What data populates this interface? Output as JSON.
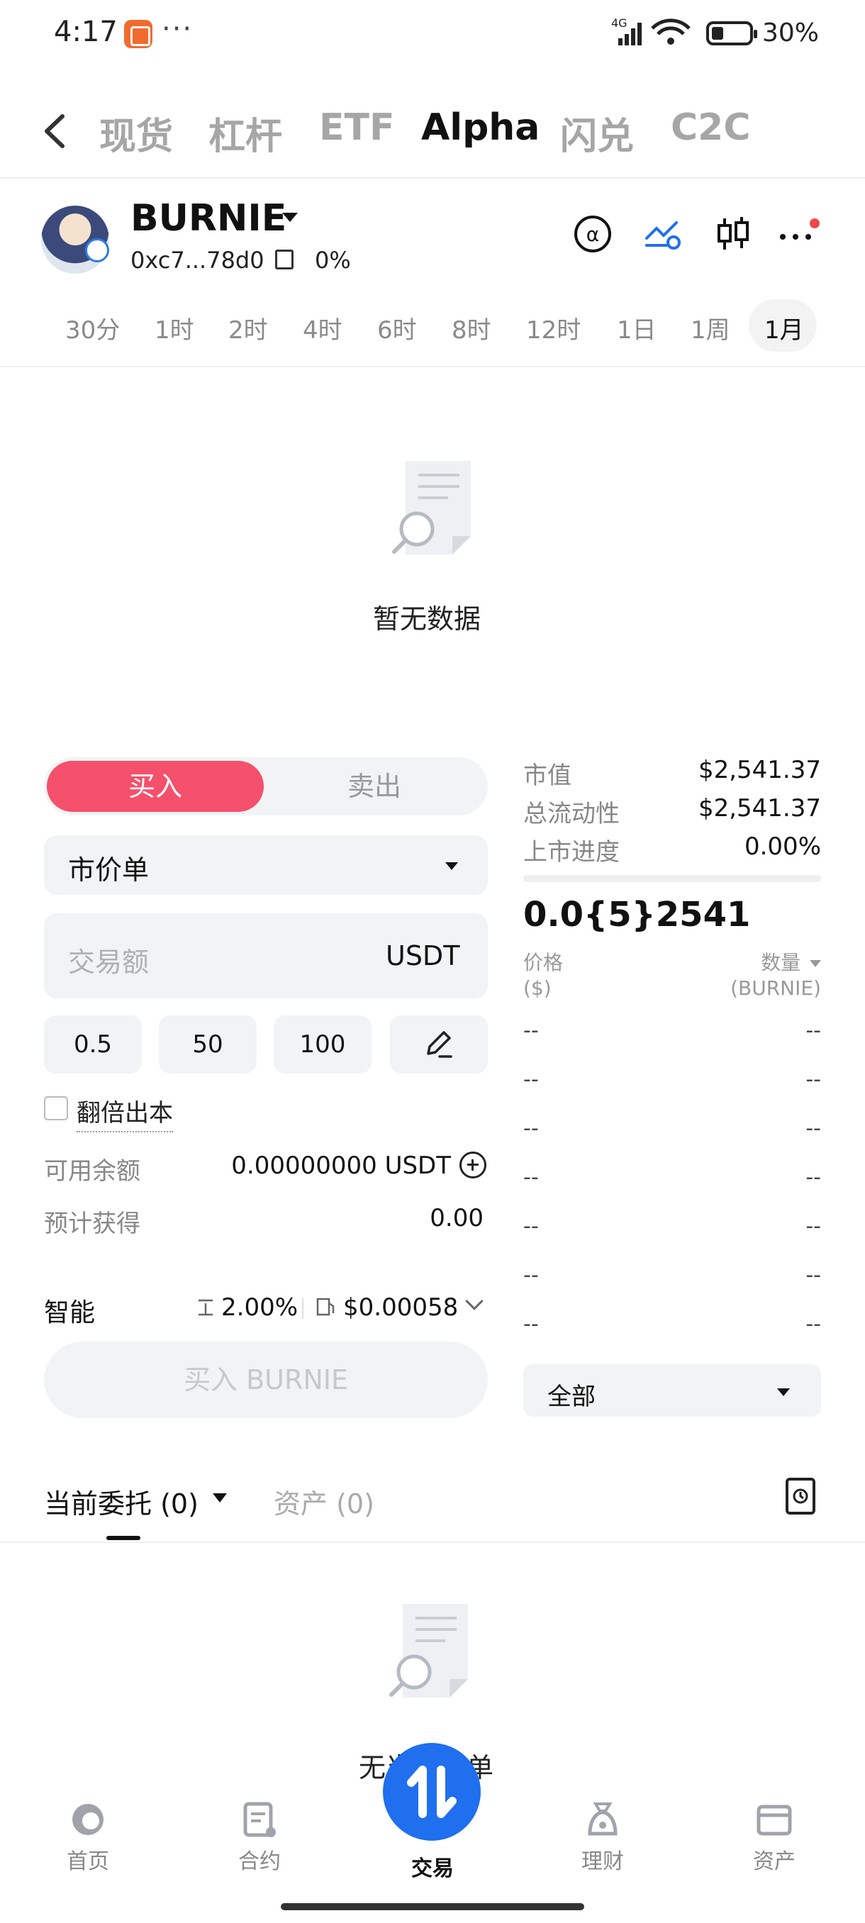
{
  "status_bar": {
    "time": "4:17",
    "dots": "···",
    "network": "4G",
    "battery_pct": "30%",
    "battery_level": 0.3
  },
  "top_tabs": [
    "现货",
    "杠杆",
    "ETF",
    "Alpha",
    "闪兑",
    "C2C"
  ],
  "top_tabs_active": "Alpha",
  "token": {
    "name": "BURNIE",
    "address": "0xc7...78d0",
    "change": "0%",
    "icons": [
      "alpha-icon",
      "trend-chart-icon",
      "candlestick-icon",
      "more-icon"
    ]
  },
  "intervals": [
    "30分",
    "1时",
    "2时",
    "4时",
    "6时",
    "8时",
    "12时",
    "1日",
    "1周",
    "1月"
  ],
  "intervals_active": "1月",
  "chart": {
    "empty_text": "暂无数据"
  },
  "trade": {
    "buy_label": "买入",
    "sell_label": "卖出",
    "order_type": "市价单",
    "amount_placeholder": "交易额",
    "amount_unit": "USDT",
    "quick_amounts": [
      "0.5",
      "50",
      "100"
    ],
    "double_label": "翻倍出本",
    "available_label": "可用余额",
    "available_value": "0.00000000 USDT",
    "expected_label": "预计获得",
    "expected_value": "0.00",
    "smart_label": "智能",
    "slippage": "2.00%",
    "fee": "$0.00058",
    "buy_button": "买入 BURNIE"
  },
  "stats": {
    "market_cap_label": "市值",
    "market_cap": "$2,541.37",
    "liquidity_label": "总流动性",
    "liquidity": "$2,541.37",
    "progress_label": "上市进度",
    "progress": "0.00%",
    "progress_fraction": 0.0
  },
  "orderbook": {
    "price": "0.0{5}2541",
    "price_header": "价格",
    "price_unit": "($)",
    "qty_header": "数量",
    "qty_unit": "(BURNIE)",
    "rows": [
      [
        "--",
        "--"
      ],
      [
        "--",
        "--"
      ],
      [
        "--",
        "--"
      ],
      [
        "--",
        "--"
      ],
      [
        "--",
        "--"
      ],
      [
        "--",
        "--"
      ],
      [
        "--",
        "--"
      ]
    ],
    "depth_select": "全部"
  },
  "orders": {
    "current_tab": "当前委托 (0)",
    "assets_tab": "资产 (0)",
    "empty_text": "无当前订单"
  },
  "nav": {
    "home": "首页",
    "futures": "合约",
    "trade": "交易",
    "earn": "理财",
    "assets": "资产"
  },
  "colors": {
    "buy": "#f5506b",
    "accent": "#1f6fef",
    "alert_dot": "#f04848"
  }
}
